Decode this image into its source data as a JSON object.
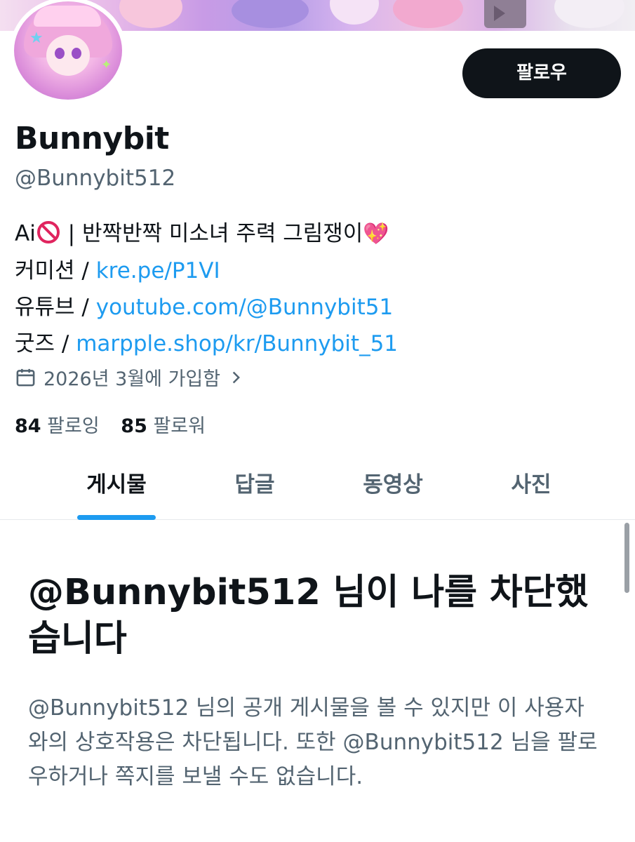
{
  "profile": {
    "follow_button": "팔로우",
    "display_name": "Bunnybit",
    "handle": "@Bunnybit512",
    "bio": {
      "line1_prefix": "Ai",
      "line1_text": " | 반짝반짝 미소녀 주력 그림쟁이",
      "line1_emoji_icon": "no-entry-icon",
      "line1_heart_icon": "sparkling-heart-icon",
      "commission_label": "커미션 / ",
      "commission_link": "kre.pe/P1VI",
      "youtube_label": "유튜브 / ",
      "youtube_link": "youtube.com/@Bunnybit51",
      "goods_label": "굿즈 / ",
      "goods_link": "marpple.shop/kr/Bunnybit_51"
    },
    "joined": "2026년 3월에 가입함",
    "following_count": "84",
    "following_label": " 팔로잉",
    "followers_count": "85",
    "followers_label": " 팔로워"
  },
  "tabs": [
    {
      "label": "게시물",
      "active": true
    },
    {
      "label": "답글",
      "active": false
    },
    {
      "label": "동영상",
      "active": false
    },
    {
      "label": "사진",
      "active": false
    }
  ],
  "blocked": {
    "title": "@Bunnybit512 님이 나를 차단했습니다",
    "description": "@Bunnybit512 님의 공개 게시물을 볼 수 있지만 이 사용자와의 상호작용은 차단됩니다. 또한 @Bunnybit512 님을 팔로우하거나 쪽지를 보낼 수도 없습니다."
  },
  "colors": {
    "link": "#1d9bf0",
    "text_primary": "#0f1419",
    "text_secondary": "#536471",
    "button_bg": "#0f1419",
    "tab_indicator": "#1d9bf0"
  }
}
